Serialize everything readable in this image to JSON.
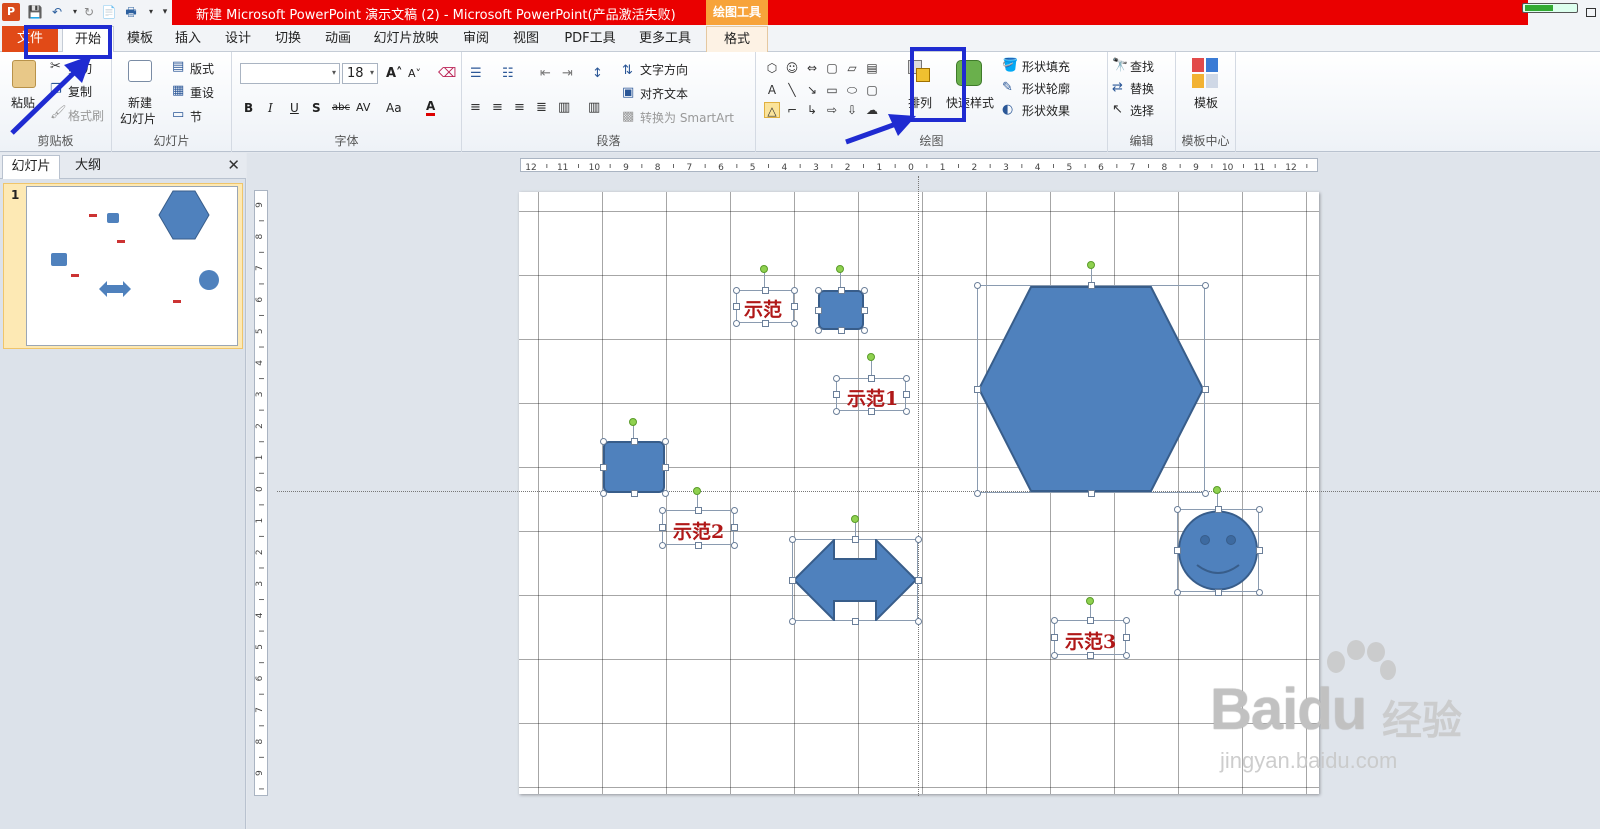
{
  "titlebar": {
    "title": "新建 Microsoft PowerPoint 演示文稿 (2) - Microsoft PowerPoint(产品激活失败)",
    "contextual_tab_title": "绘图工具",
    "app_logo": "P"
  },
  "tabs": [
    {
      "label": "文件"
    },
    {
      "label": "开始"
    },
    {
      "label": "模板"
    },
    {
      "label": "插入"
    },
    {
      "label": "设计"
    },
    {
      "label": "切换"
    },
    {
      "label": "动画"
    },
    {
      "label": "幻灯片放映"
    },
    {
      "label": "审阅"
    },
    {
      "label": "视图"
    },
    {
      "label": "PDF工具"
    },
    {
      "label": "更多工具"
    },
    {
      "label": "格式"
    }
  ],
  "ribbon": {
    "clipboard": {
      "label": "剪贴板",
      "paste": "粘贴",
      "cut": "剪切",
      "copy": "复制",
      "format_painter": "格式刷"
    },
    "slides": {
      "label": "幻灯片",
      "new_slide": "新建",
      "new_slide2": "幻灯片",
      "layout": "版式",
      "reset": "重设",
      "section": "节"
    },
    "font": {
      "label": "字体",
      "font_size": "18",
      "bold": "B",
      "italic": "I",
      "underline": "U",
      "shadow": "S",
      "strike": "abc",
      "spacing": "AV",
      "case": "Aa",
      "color": "A"
    },
    "paragraph": {
      "label": "段落",
      "text_direction": "文字方向",
      "align_text": "对齐文本",
      "convert_smartart": "转换为 SmartArt"
    },
    "drawing": {
      "label": "绘图",
      "arrange": "排列",
      "quick_styles": "快速样式",
      "shape_fill": "形状填充",
      "shape_outline": "形状轮廓",
      "shape_effects": "形状效果"
    },
    "editing": {
      "label": "编辑",
      "find": "查找",
      "replace": "替换",
      "select": "选择"
    },
    "template_center": {
      "label": "模板中心",
      "template": "模板"
    }
  },
  "leftpane": {
    "tab_slides": "幻灯片",
    "tab_outline": "大纲",
    "slide_number": "1"
  },
  "slide": {
    "labels": [
      "示范",
      "示范1",
      "示范2",
      "示范3"
    ]
  },
  "ruler": {
    "h_ticks": [
      "12",
      "11",
      "10",
      "9",
      "8",
      "7",
      "6",
      "5",
      "4",
      "3",
      "2",
      "1",
      "0",
      "1",
      "2",
      "3",
      "4",
      "5",
      "6",
      "7",
      "8",
      "9",
      "10",
      "11",
      "12"
    ],
    "v_ticks": [
      "9",
      "8",
      "7",
      "6",
      "5",
      "4",
      "3",
      "2",
      "1",
      "0",
      "1",
      "2",
      "3",
      "4",
      "5",
      "6",
      "7",
      "8",
      "9"
    ]
  },
  "watermark": {
    "brand": "Bai",
    "brand2": "du",
    "cn": "经验",
    "url": "jingyan.baidu.com"
  },
  "colors": {
    "shape_fill": "#4f81bd",
    "shape_stroke": "#385d8a",
    "label_text": "#b01818",
    "annotation_blue": "#1f2bd1",
    "title_red": "#ea0000"
  }
}
